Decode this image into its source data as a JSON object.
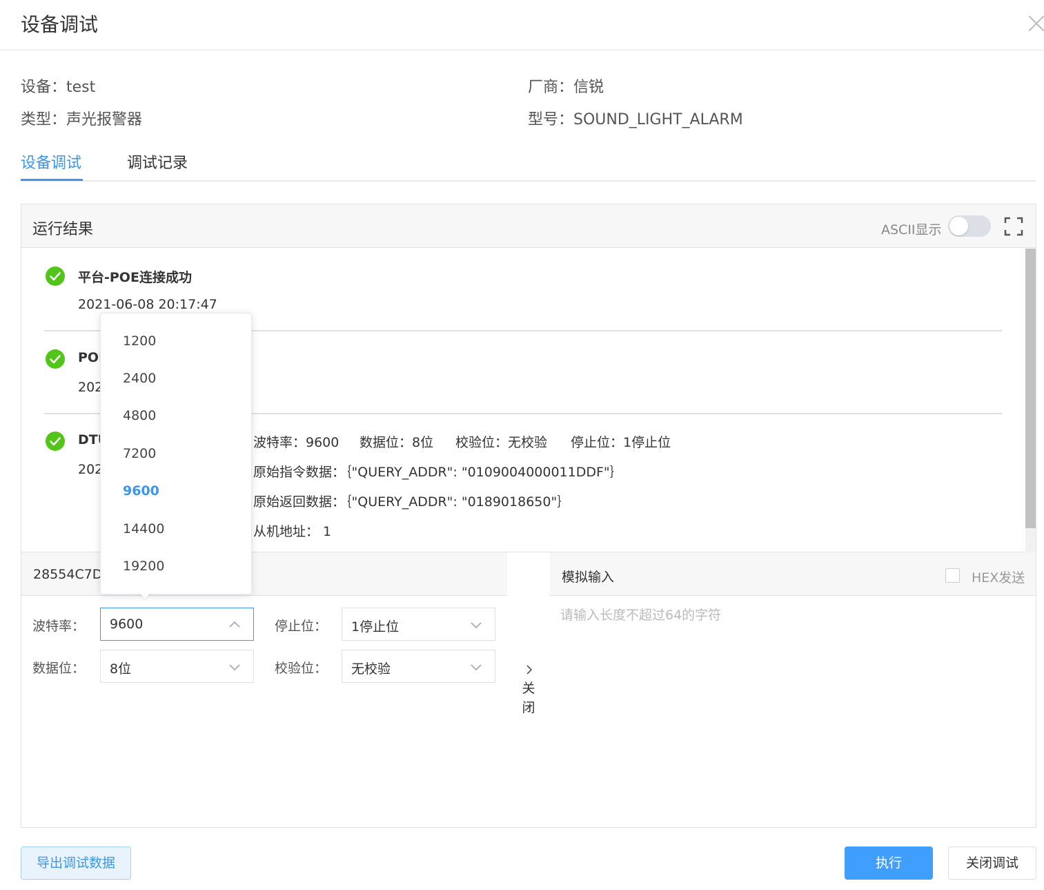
{
  "dialog": {
    "title": "设备调试"
  },
  "info": {
    "device": "设备：test",
    "vendor": "厂商：信锐",
    "type": "类型：声光报警器",
    "model": "型号：SOUND_LIGHT_ALARM"
  },
  "tabs": [
    {
      "label": "设备调试",
      "active": true
    },
    {
      "label": "调试记录",
      "active": false
    }
  ],
  "result": {
    "title": "运行结果",
    "ascii_label": "ASCII显示",
    "ascii_on": false,
    "entries": [
      {
        "title": "平台-POE连接成功",
        "time": "2021-06-08 20:17:47"
      },
      {
        "title": "POI",
        "time": "202"
      },
      {
        "title": "DTU",
        "time": "202"
      }
    ],
    "details": {
      "baud": "波特率：9600",
      "databits": "数据位：8位",
      "parity": "校验位：无校验",
      "stopbits": "停止位：1停止位",
      "raw_cmd": "原始指令数据：｛\"QUERY_ADDR\": \"0109004000011DDF\"｝",
      "raw_ret": "原始返回数据：｛\"QUERY_ADDR\": \"0189018650\"｝",
      "slave": "从机地址：  1"
    }
  },
  "serial": {
    "header_id": "28554C7D",
    "baud_label": "波特率：",
    "baud_value": "9600",
    "stop_label": "停止位：",
    "stop_value": "1停止位",
    "data_label": "数据位：",
    "data_value": "8位",
    "parity_label": "校验位：",
    "parity_value": "无校验"
  },
  "collapse": {
    "label": "关闭"
  },
  "simulate": {
    "title": "模拟输入",
    "hex_label": "HEX发送",
    "hex_checked": false,
    "placeholder": "请输入长度不超过64的字符"
  },
  "baud_dropdown": {
    "options": [
      "1200",
      "2400",
      "4800",
      "7200",
      "9600",
      "14400",
      "19200"
    ],
    "selected": "9600"
  },
  "buttons": {
    "export": "导出调试数据",
    "run": "执行",
    "close": "关闭调试"
  },
  "colors": {
    "accent": "#3d96ee",
    "success": "#52c41a"
  }
}
